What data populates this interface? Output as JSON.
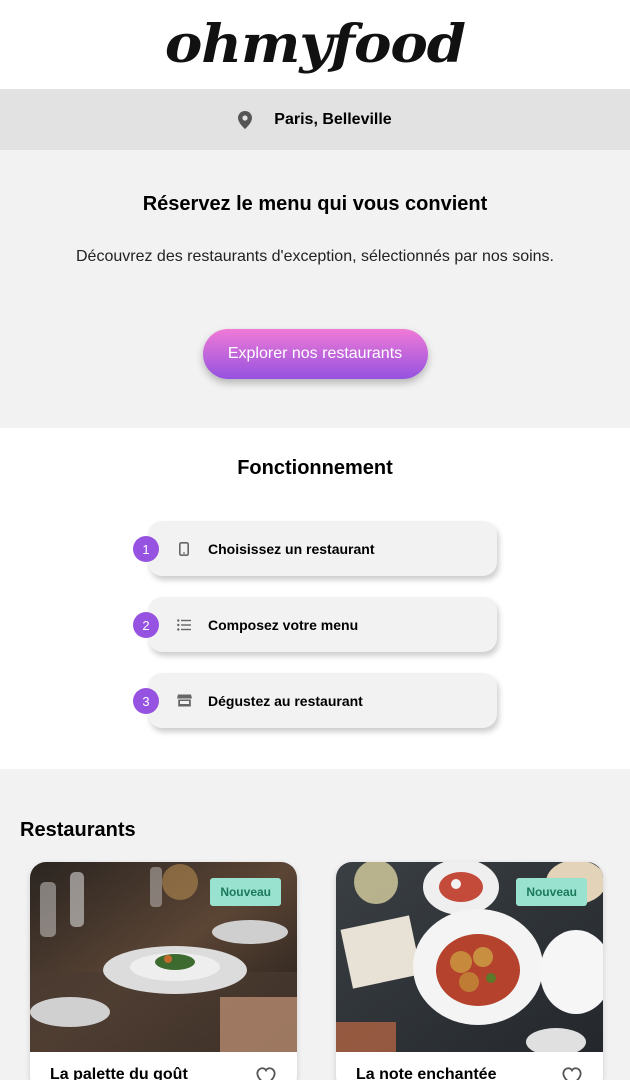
{
  "header": {
    "logo_text": "ohmyfood"
  },
  "location": {
    "icon": "map-pin-icon",
    "text": "Paris, Belleville"
  },
  "hero": {
    "title": "Réservez le menu qui vous convient",
    "subtitle": "Découvrez des restaurants d'exception, sélectionnés par nos soins.",
    "cta_label": "Explorer nos restaurants",
    "cta_colors": [
      "#f07ad6",
      "#9552e0"
    ]
  },
  "how": {
    "title": "Fonctionnement",
    "steps": [
      {
        "number": "1",
        "icon": "mobile-phone-icon",
        "label": "Choisissez un restaurant"
      },
      {
        "number": "2",
        "icon": "list-icon",
        "label": "Composez votre menu"
      },
      {
        "number": "3",
        "icon": "store-icon",
        "label": "Dégustez au restaurant"
      }
    ]
  },
  "restaurants": {
    "title": "Restaurants",
    "items": [
      {
        "name": "La palette du goût",
        "badge": "Nouveau",
        "icon": "heart-icon"
      },
      {
        "name": "La note enchantée",
        "badge": "Nouveau",
        "icon": "heart-icon"
      }
    ]
  },
  "colors": {
    "accent": "#9652e0",
    "badge_bg": "#99e2d0",
    "badge_text": "#1b7a5a",
    "section_bg": "#f2f2f2"
  }
}
